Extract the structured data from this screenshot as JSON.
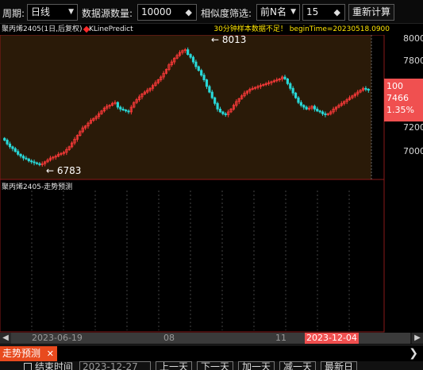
{
  "toolbar": {
    "period_label": "周期:",
    "period_value": "日线",
    "source_count_label": "数据源数量:",
    "source_count_value": "10000",
    "filter_label": "相似度筛选:",
    "filter_mode_value": "前N名",
    "filter_n_value": "15",
    "recalc_label": "重新计算"
  },
  "chart": {
    "title": "聚丙烯2405(1日,后复权)",
    "indicator": "KLinePredict",
    "warning": "30分钟样本数据不足！ beginTime=20230518.0900",
    "max_label": "8013",
    "min_label": "6783",
    "y_ticks": [
      "8000",
      "7800",
      "7200",
      "7000"
    ],
    "info": {
      "line1": "100",
      "line2": "7466",
      "line3": "1.35%"
    },
    "sub_title": "聚丙烯2405-走势预测",
    "colors": {
      "up": "#ff3a3a",
      "down": "#28d8d8",
      "panel_bg": "#2a1a08",
      "info_box": "#f05050"
    }
  },
  "chart_data": {
    "type": "candlestick",
    "title": "聚丙烯2405(1日,后复权)",
    "ylim": [
      6650,
      8150
    ],
    "y_ticks": [
      7000,
      7200,
      7466,
      7800,
      8000
    ],
    "max": 8013,
    "min": 6783,
    "last": 7466,
    "x_tick_labels": [
      "2023-06-19",
      "08",
      "11",
      "2023-12-04"
    ],
    "close": [
      7050,
      7010,
      6980,
      6960,
      6930,
      6900,
      6880,
      6860,
      6850,
      6830,
      6820,
      6810,
      6800,
      6790,
      6800,
      6820,
      6840,
      6860,
      6870,
      6880,
      6900,
      6910,
      6920,
      6950,
      6980,
      7020,
      7060,
      7100,
      7140,
      7180,
      7200,
      7230,
      7260,
      7280,
      7300,
      7330,
      7360,
      7390,
      7410,
      7420,
      7440,
      7450,
      7400,
      7380,
      7370,
      7360,
      7350,
      7400,
      7450,
      7480,
      7510,
      7540,
      7560,
      7580,
      7600,
      7630,
      7660,
      7690,
      7720,
      7760,
      7800,
      7850,
      7880,
      7920,
      7950,
      7980,
      8000,
      8010,
      7960,
      7930,
      7880,
      7830,
      7790,
      7740,
      7690,
      7620,
      7560,
      7500,
      7440,
      7380,
      7350,
      7330,
      7320,
      7350,
      7380,
      7420,
      7460,
      7490,
      7520,
      7550,
      7570,
      7590,
      7600,
      7610,
      7620,
      7630,
      7640,
      7650,
      7660,
      7670,
      7680,
      7690,
      7700,
      7720,
      7700,
      7650,
      7600,
      7550,
      7500,
      7450,
      7420,
      7400,
      7380,
      7390,
      7410,
      7380,
      7360,
      7350,
      7330,
      7320,
      7330,
      7350,
      7380,
      7400,
      7420,
      7440,
      7460,
      7480,
      7500,
      7520,
      7540,
      7560,
      7580,
      7600,
      7590,
      7580
    ]
  },
  "scroll": {
    "date_start": "2023-06-19",
    "tick_08": "08",
    "tick_11": "11",
    "date_highlight": "2023-12-04"
  },
  "tabs": {
    "active": "走势预测",
    "close": "✕",
    "next": "❯"
  },
  "bottom": {
    "end_time_label": "结束时间",
    "end_date": "2023-12-27",
    "prev": "上一天",
    "next": "下一天",
    "plus_day": "加一天",
    "minus_day": "减一天",
    "latest": "最新日"
  }
}
